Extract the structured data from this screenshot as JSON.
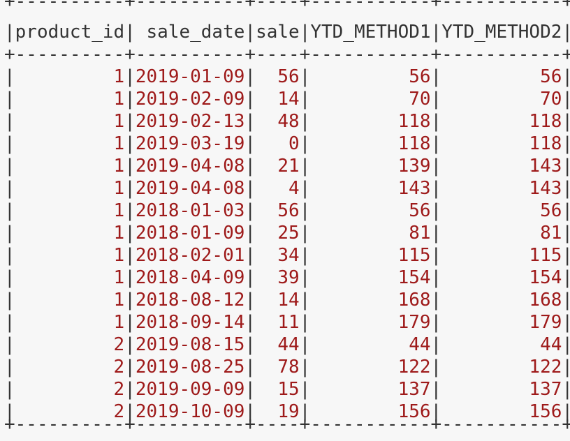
{
  "table": {
    "border_line": "+----------+----------+----+-----------+-----------+",
    "columns": [
      "product_id",
      "sale_date",
      "sale",
      "YTD_METHOD1",
      "YTD_METHOD2"
    ],
    "widths": [
      10,
      10,
      4,
      11,
      11
    ],
    "rows": [
      [
        "1",
        "2019-01-09",
        "56",
        "56",
        "56"
      ],
      [
        "1",
        "2019-02-09",
        "14",
        "70",
        "70"
      ],
      [
        "1",
        "2019-02-13",
        "48",
        "118",
        "118"
      ],
      [
        "1",
        "2019-03-19",
        "0",
        "118",
        "118"
      ],
      [
        "1",
        "2019-04-08",
        "21",
        "139",
        "143"
      ],
      [
        "1",
        "2019-04-08",
        "4",
        "143",
        "143"
      ],
      [
        "1",
        "2018-01-03",
        "56",
        "56",
        "56"
      ],
      [
        "1",
        "2018-01-09",
        "25",
        "81",
        "81"
      ],
      [
        "1",
        "2018-02-01",
        "34",
        "115",
        "115"
      ],
      [
        "1",
        "2018-04-09",
        "39",
        "154",
        "154"
      ],
      [
        "1",
        "2018-08-12",
        "14",
        "168",
        "168"
      ],
      [
        "1",
        "2018-09-14",
        "11",
        "179",
        "179"
      ],
      [
        "2",
        "2019-08-15",
        "44",
        "44",
        "44"
      ],
      [
        "2",
        "2019-08-25",
        "78",
        "122",
        "122"
      ],
      [
        "2",
        "2019-09-09",
        "15",
        "137",
        "137"
      ],
      [
        "2",
        "2019-10-09",
        "19",
        "156",
        "156"
      ]
    ]
  },
  "colors": {
    "text": "#333333",
    "value": "#9e1a1a",
    "background": "#f7f7f7"
  }
}
